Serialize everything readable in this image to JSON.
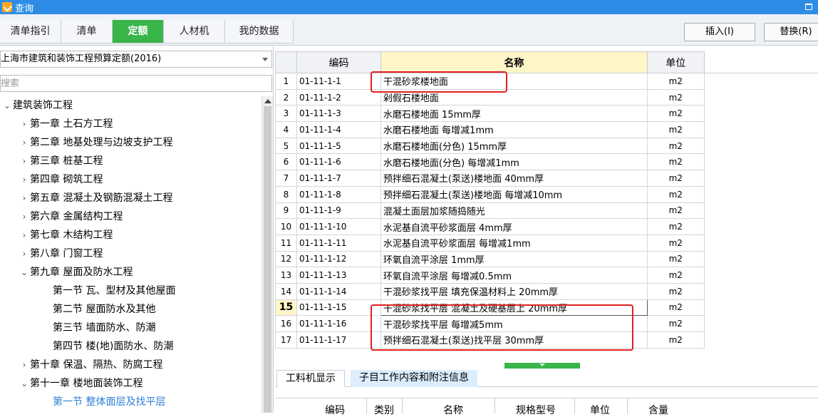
{
  "window": {
    "title": "查询"
  },
  "tabs": [
    {
      "label": "清单指引",
      "active": false
    },
    {
      "label": "清单",
      "active": false
    },
    {
      "label": "定额",
      "active": true
    },
    {
      "label": "人材机",
      "active": false
    },
    {
      "label": "我的数据",
      "active": false
    }
  ],
  "toolbar": {
    "insert_label": "插入(I)",
    "replace_label": "替换(R)"
  },
  "left": {
    "quota_select": "上海市建筑和装饰工程预算定额(2016)",
    "search_placeholder": "搜索",
    "tree": [
      {
        "label": "建筑装饰工程",
        "arrow": "⌄",
        "level": 0
      },
      {
        "label": "第一章 土石方工程",
        "arrow": "›",
        "level": 1
      },
      {
        "label": "第二章 地基处理与边坡支护工程",
        "arrow": "›",
        "level": 1
      },
      {
        "label": "第三章 桩基工程",
        "arrow": "›",
        "level": 1
      },
      {
        "label": "第四章 砌筑工程",
        "arrow": "›",
        "level": 1
      },
      {
        "label": "第五章 混凝土及钢筋混凝土工程",
        "arrow": "›",
        "level": 1
      },
      {
        "label": "第六章 金属结构工程",
        "arrow": "›",
        "level": 1
      },
      {
        "label": "第七章 木结构工程",
        "arrow": "›",
        "level": 1
      },
      {
        "label": "第八章 门窗工程",
        "arrow": "›",
        "level": 1
      },
      {
        "label": "第九章 屋面及防水工程",
        "arrow": "⌄",
        "level": 1
      },
      {
        "label": "第一节 瓦、型材及其他屋面",
        "arrow": "",
        "level": 2
      },
      {
        "label": "第二节 屋面防水及其他",
        "arrow": "",
        "level": 2
      },
      {
        "label": "第三节 墙面防水、防潮",
        "arrow": "",
        "level": 2
      },
      {
        "label": "第四节 楼(地)面防水、防潮",
        "arrow": "",
        "level": 2
      },
      {
        "label": "第十章 保温、隔热、防腐工程",
        "arrow": "›",
        "level": 1
      },
      {
        "label": "第十一章 楼地面装饰工程",
        "arrow": "⌄",
        "level": 1
      },
      {
        "label": "第一节 整体面层及找平层",
        "arrow": "",
        "level": 2,
        "selected": true
      }
    ]
  },
  "grid": {
    "headers": {
      "code": "编码",
      "name": "名称",
      "unit": "单位"
    },
    "current_row": 15,
    "rows": [
      {
        "no": "1",
        "code": "01-11-1-1",
        "name": "干混砂浆楼地面",
        "unit": "m2"
      },
      {
        "no": "2",
        "code": "01-11-1-2",
        "name": "剁假石楼地面",
        "unit": "m2"
      },
      {
        "no": "3",
        "code": "01-11-1-3",
        "name": "水磨石楼地面 15mm厚",
        "unit": "m2"
      },
      {
        "no": "4",
        "code": "01-11-1-4",
        "name": "水磨石楼地面 每增减1mm",
        "unit": "m2"
      },
      {
        "no": "5",
        "code": "01-11-1-5",
        "name": "水磨石楼地面(分色) 15mm厚",
        "unit": "m2"
      },
      {
        "no": "6",
        "code": "01-11-1-6",
        "name": "水磨石楼地面(分色) 每增减1mm",
        "unit": "m2"
      },
      {
        "no": "7",
        "code": "01-11-1-7",
        "name": "预拌细石混凝土(泵送)楼地面 40mm厚",
        "unit": "m2"
      },
      {
        "no": "8",
        "code": "01-11-1-8",
        "name": "预拌细石混凝土(泵送)楼地面 每增减10mm",
        "unit": "m2"
      },
      {
        "no": "9",
        "code": "01-11-1-9",
        "name": "混凝土面层加浆随捣随光",
        "unit": "m2"
      },
      {
        "no": "10",
        "code": "01-11-1-10",
        "name": "水泥基自流平砂浆面层 4mm厚",
        "unit": "m2"
      },
      {
        "no": "11",
        "code": "01-11-1-11",
        "name": "水泥基自流平砂浆面层 每增减1mm",
        "unit": "m2"
      },
      {
        "no": "12",
        "code": "01-11-1-12",
        "name": "环氧自流平涂层 1mm厚",
        "unit": "m2"
      },
      {
        "no": "13",
        "code": "01-11-1-13",
        "name": "环氧自流平涂层 每增减0.5mm",
        "unit": "m2"
      },
      {
        "no": "14",
        "code": "01-11-1-14",
        "name": "干混砂浆找平层 填充保温材料上 20mm厚",
        "unit": "m2"
      },
      {
        "no": "15",
        "code": "01-11-1-15",
        "name": "干混砂浆找平层 混凝土及硬基层上 20mm厚",
        "unit": "m2"
      },
      {
        "no": "16",
        "code": "01-11-1-16",
        "name": "干混砂浆找平层 每增减5mm",
        "unit": "m2"
      },
      {
        "no": "17",
        "code": "01-11-1-17",
        "name": "预拌细石混凝土(泵送)找平层 30mm厚",
        "unit": "m2"
      }
    ]
  },
  "bottom": {
    "tabs": [
      {
        "label": "工料机显示",
        "active": true
      },
      {
        "label": "子目工作内容和附注信息",
        "active": false
      }
    ],
    "headers": [
      "编码",
      "类别",
      "名称",
      "规格型号",
      "单位",
      "含量"
    ]
  },
  "colors": {
    "titlebar": "#2d8de6",
    "active_tab": "#39b54a",
    "highlight": "#e0201f",
    "name_header": "#fff6c8"
  }
}
